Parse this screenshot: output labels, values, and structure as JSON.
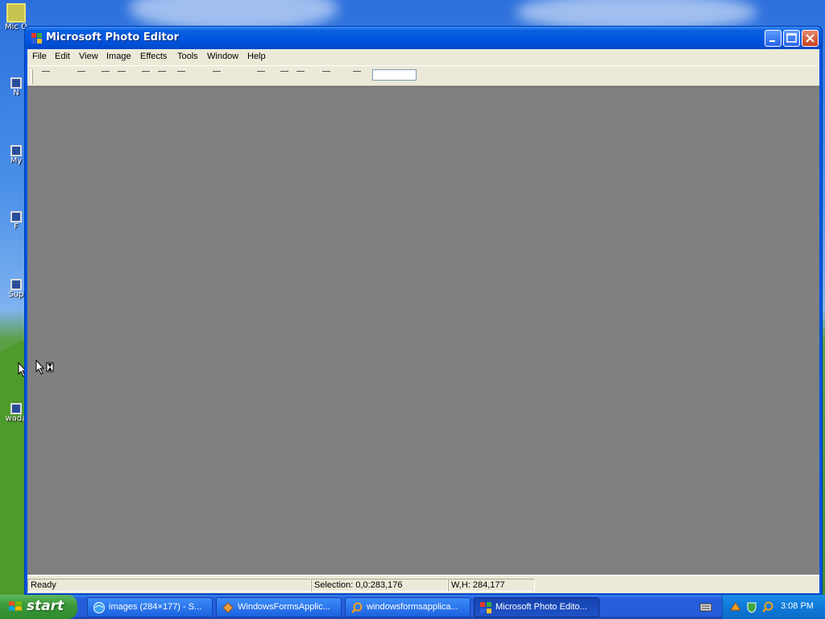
{
  "desktop": {
    "icons": [
      {
        "label": "Mic O"
      },
      {
        "label": "N"
      },
      {
        "label": "My"
      },
      {
        "label": "F"
      },
      {
        "label": "Sup"
      },
      {
        "label": "wada"
      }
    ]
  },
  "window": {
    "title": "Microsoft Photo Editor",
    "icon": "photo-editor-icon",
    "buttons": {
      "minimize": "minimize-icon",
      "maximize": "maximize-icon",
      "close": "close-icon"
    }
  },
  "menubar": [
    "File",
    "Edit",
    "View",
    "Image",
    "Effects",
    "Tools",
    "Window",
    "Help"
  ],
  "statusbar": {
    "status": "Ready",
    "selection": "Selection: 0,0:283,176",
    "size": "W,H: 284,177"
  },
  "taskbar": {
    "start_label": "start",
    "tasks": [
      {
        "label": "images (284×177) - S...",
        "icon": "browser-icon",
        "active": false
      },
      {
        "label": "WindowsFormsApplic...",
        "icon": "visual-studio-icon",
        "active": false
      },
      {
        "label": "windowsformsapplica...",
        "icon": "search-icon",
        "active": false
      },
      {
        "label": "Microsoft Photo Edito...",
        "icon": "photo-editor-icon",
        "active": true
      }
    ],
    "clock": "3:08 PM"
  },
  "colors": {
    "titlebar": "#0055e0",
    "canvas": "#808080",
    "chrome": "#ece9d8",
    "taskbar": "#245edb",
    "start": "#3c9a3c"
  }
}
